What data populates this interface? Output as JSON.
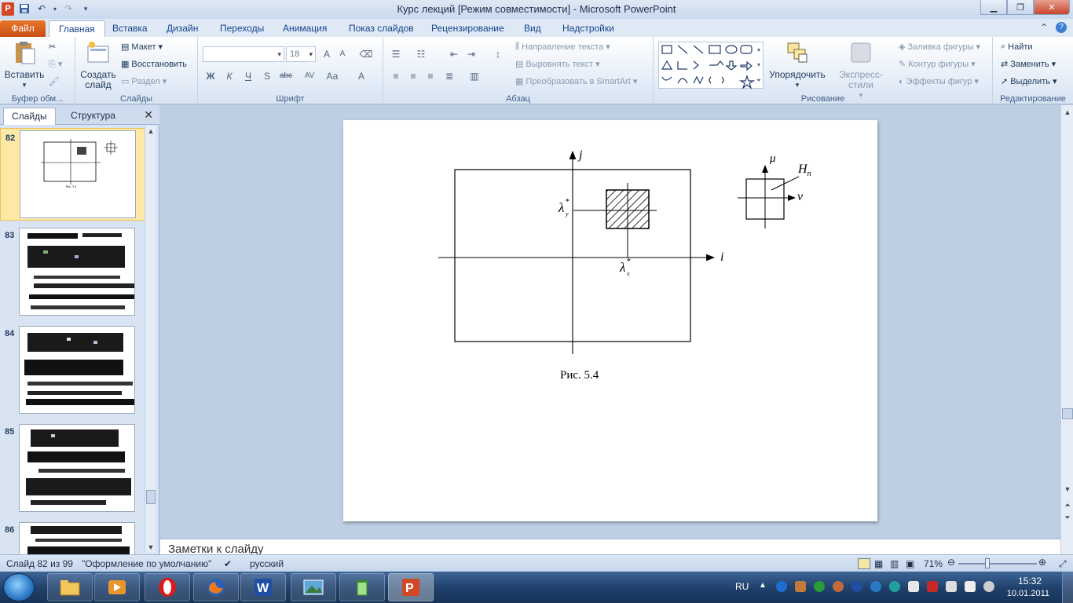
{
  "window": {
    "title": "Курс лекций [Режим совместимости]  -  Microsoft PowerPoint",
    "app_icon": "powerpoint-icon",
    "app_icon_letter": "P"
  },
  "tabs": [
    {
      "label": "Файл"
    },
    {
      "label": "Главная"
    },
    {
      "label": "Вставка"
    },
    {
      "label": "Дизайн"
    },
    {
      "label": "Переходы"
    },
    {
      "label": "Анимация"
    },
    {
      "label": "Показ слайдов"
    },
    {
      "label": "Рецензирование"
    },
    {
      "label": "Вид"
    },
    {
      "label": "Надстройки"
    }
  ],
  "ribbon": {
    "clipboard": {
      "paste": "Вставить",
      "label": "Буфер обм..."
    },
    "slides": {
      "new_slide": "Создать слайд",
      "layout": "Макет",
      "reset": "Восстановить",
      "section": "Раздел",
      "label": "Слайды"
    },
    "font": {
      "size": "18",
      "label": "Шрифт",
      "bold": "Ж",
      "italic": "К",
      "underline": "Ч",
      "shadow": "S",
      "strike": "abc",
      "spacing": "AV",
      "case": "Aa",
      "color": "A",
      "grow": "A",
      "shrink": "A"
    },
    "paragraph": {
      "text_direction": "Направление текста",
      "align_text": "Выровнять текст",
      "smartart": "Преобразовать в SmartArt",
      "label": "Абзац"
    },
    "drawing": {
      "arrange": "Упорядочить",
      "quick_styles": "Экспресс-стили",
      "fill": "Заливка фигуры",
      "outline": "Контур фигуры",
      "effects": "Эффекты фигур",
      "label": "Рисование"
    },
    "editing": {
      "find": "Найти",
      "replace": "Заменить",
      "select": "Выделить",
      "label": "Редактирование"
    }
  },
  "left_panel": {
    "tab_slides": "Слайды",
    "tab_outline": "Структура",
    "thumbnails": [
      {
        "number": "82",
        "selected": true,
        "caption": "Рис. 5.4"
      },
      {
        "number": "83"
      },
      {
        "number": "84"
      },
      {
        "number": "85"
      },
      {
        "number": "86"
      }
    ]
  },
  "slide": {
    "caption": "Рис. 5.4",
    "labels": {
      "j": "j",
      "i": "i",
      "mu": "μ",
      "nu": "ν",
      "H": "H",
      "H_sub": "n",
      "lambda_y": "λ",
      "lambda_y_sub": "y",
      "lambda_x": "λ",
      "lambda_x_sub": "x",
      "star": "*"
    }
  },
  "notes": {
    "placeholder": "Заметки к слайду"
  },
  "status": {
    "slide_info": "Слайд 82 из 99",
    "theme": "\"Оформление по умолчанию\"",
    "language": "русский",
    "zoom": "71%",
    "zoom_level": 0.71
  },
  "taskbar": {
    "lang": "RU",
    "time": "15:32",
    "date": "10.01.2011",
    "apps": [
      "explorer",
      "media-player",
      "opera",
      "firefox",
      "word",
      "image-viewer",
      "recycle",
      "powerpoint"
    ]
  }
}
